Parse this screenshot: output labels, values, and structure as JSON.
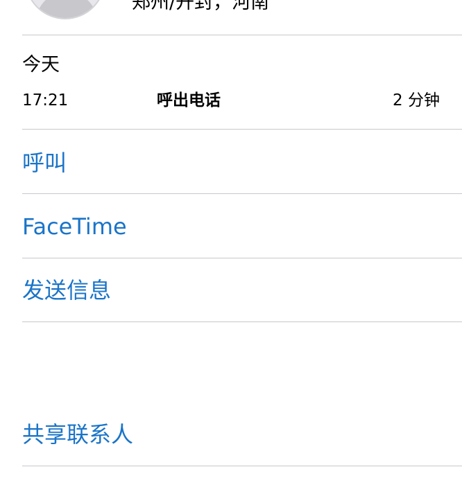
{
  "contact": {
    "avatar_icon": "person-silhouette-icon",
    "location": "郑州/开封，河南"
  },
  "recent_calls": {
    "day_label": "今天",
    "entries": [
      {
        "time": "17:21",
        "type": "呼出电话",
        "duration": "2 分钟"
      }
    ]
  },
  "actions": {
    "call_label": "呼叫",
    "facetime_label": "FaceTime",
    "message_label": "发送信息",
    "share_contact_label": "共享联系人"
  },
  "colors": {
    "action_blue": "#1a74c8",
    "separator": "#c8c7cc"
  }
}
